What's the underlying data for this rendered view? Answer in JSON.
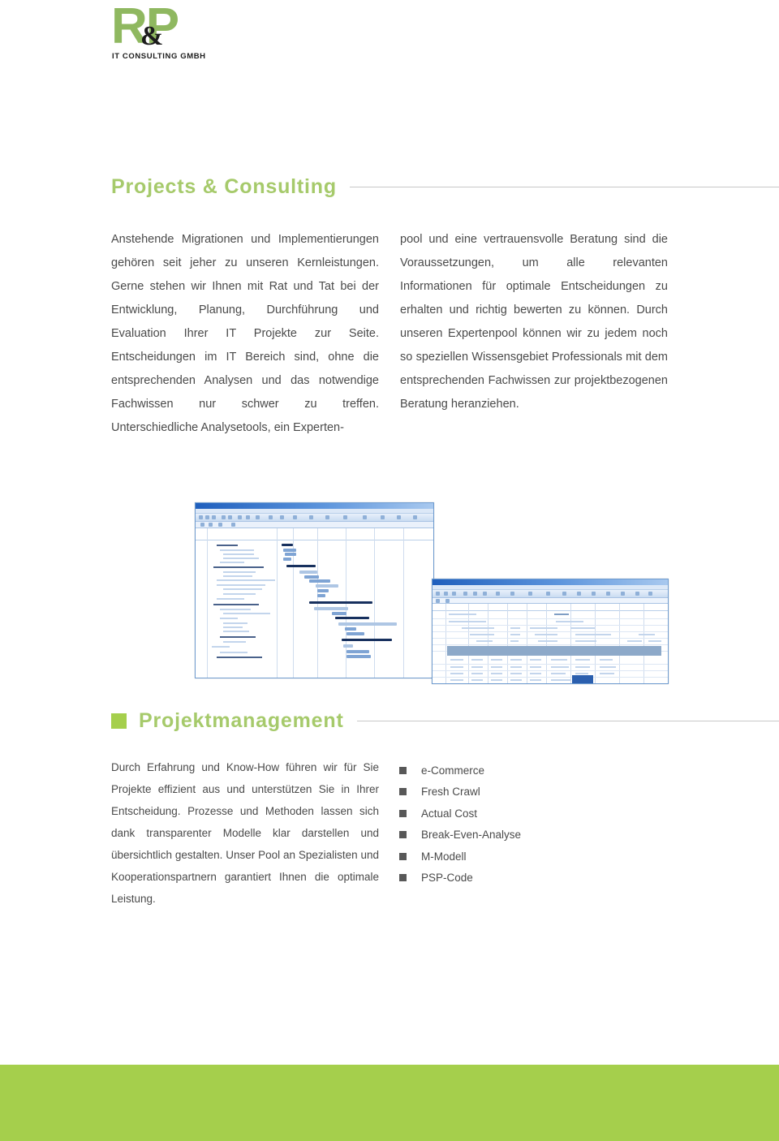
{
  "logo": {
    "letters": "RP",
    "ampersand": "&",
    "subtitle": "IT CONSULTING GMBH",
    "brand_color": "#8fb860",
    "text_color": "#1c1c1c"
  },
  "sections": [
    {
      "id": "projects-consulting",
      "title": "Projects & Consulting",
      "has_bullet": false,
      "columns": {
        "left": "Anstehende Migrationen und Implementierungen gehören seit jeher zu unseren Kernleistungen. Gerne stehen wir Ihnen mit Rat und Tat bei der Entwicklung, Planung, Durchführung und Evaluation Ihrer IT Projekte zur Seite. Entscheidungen im IT Bereich sind, ohne die entsprechenden Analysen und das notwendige Fachwissen nur schwer zu treffen. Unterschiedliche Analysetools, ein Experten-",
        "right": "pool und eine vertrauensvolle Beratung sind die Voraussetzungen, um alle relevanten Informationen für optimale Entscheidungen zu erhalten und richtig bewerten zu können. Durch unseren Expertenpool können wir zu jedem noch so speziellen Wissensgebiet Professionals mit dem entsprechenden Fachwissen zur projektbezogenen Beratung heranziehen."
      }
    },
    {
      "id": "projektmanagement",
      "title": "Projektmanagement",
      "has_bullet": true,
      "columns": {
        "left": "Durch Erfahrung und Know-How führen wir für Sie Projekte effizient aus und unterstützen Sie in Ihrer Entscheidung. Prozesse und Methoden lassen sich dank transparenter Modelle klar darstellen und übersichtlich gestalten. Unser Pool an Spezialisten und Kooperationspartnern garantiert Ihnen die optimale Leistung."
      },
      "bullet_list": [
        "e-Commerce",
        "Fresh Crawl",
        "Actual Cost",
        "Break-Even-Analyse",
        "M-Modell",
        "PSP-Code"
      ]
    }
  ],
  "figures": [
    {
      "id": "gantt-screenshot",
      "name": "project-management-gantt-screenshot",
      "caption": ""
    },
    {
      "id": "spreadsheet-screenshot",
      "name": "cost-spreadsheet-screenshot",
      "caption": ""
    }
  ],
  "theme": {
    "accent_green": "#a5cf4c",
    "heading_green": "#a6ca6b",
    "body_text": "#4a4a4a",
    "rule_gray": "#c8c8c8",
    "bullet_dark": "#585858",
    "footer_green": "#a5cf4c"
  }
}
